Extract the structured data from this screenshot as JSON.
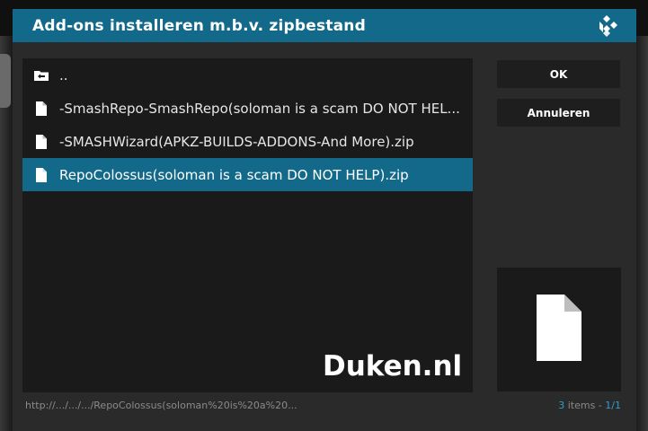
{
  "dialog": {
    "title": "Add-ons installeren m.b.v. zipbestand",
    "logo_icon": "kodi-logo-icon"
  },
  "file_list": {
    "items": [
      {
        "label": "..",
        "icon": "folder-up-icon",
        "selected": false
      },
      {
        "label": "-SmashRepo-SmashRepo(soloman is a scam DO NOT HEL...",
        "icon": "file-icon",
        "selected": false
      },
      {
        "label": "-SMASHWizard(APKZ-BUILDS-ADDONS-And More).zip",
        "icon": "file-icon",
        "selected": false
      },
      {
        "label": "RepoColossus(soloman is a scam DO NOT HELP).zip",
        "icon": "file-icon",
        "selected": true
      }
    ]
  },
  "buttons": {
    "ok_label": "OK",
    "cancel_label": "Annuleren"
  },
  "watermark": "Duken.nl",
  "status": {
    "path": "http://.../.../.../RepoColossus(soloman%20is%20a%20...",
    "count_number": "3",
    "count_suffix": " items - ",
    "page": "1/1"
  },
  "colors": {
    "accent": "#12698a",
    "accent_text": "#2f9ed1"
  }
}
